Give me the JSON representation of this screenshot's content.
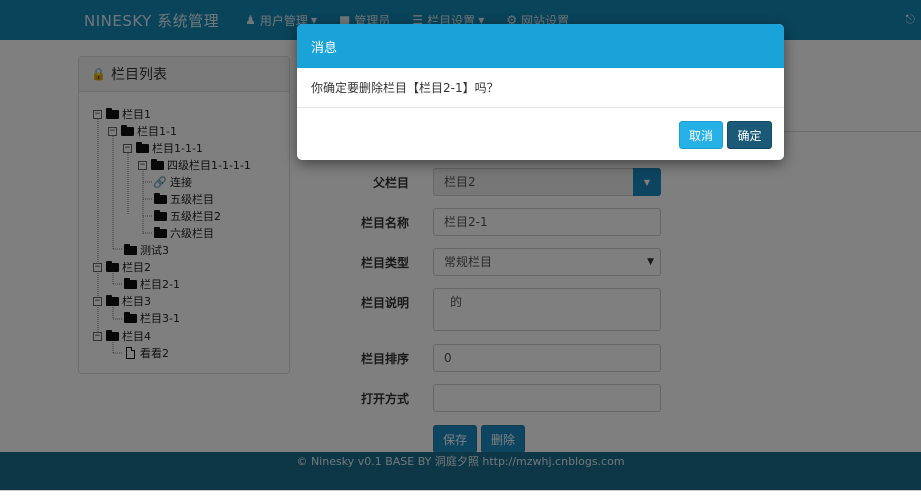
{
  "navbar": {
    "brand": "NINESKY 系统管理",
    "items": [
      {
        "label": "用户管理",
        "icon": "user-icon",
        "dropdown": true
      },
      {
        "label": "管理员",
        "icon": "lock-icon",
        "dropdown": false
      },
      {
        "label": "栏目设置",
        "icon": "list-icon",
        "dropdown": true
      },
      {
        "label": "网站设置",
        "icon": "gear-icon",
        "dropdown": false
      }
    ],
    "right_icon": "logout-icon"
  },
  "sidebar": {
    "title": "栏目列表",
    "tree": [
      {
        "label": "栏目1",
        "type": "folder",
        "expanded": true
      },
      {
        "label": "栏目1-1",
        "type": "folder",
        "expanded": true
      },
      {
        "label": "栏目1-1-1",
        "type": "folder",
        "expanded": true
      },
      {
        "label": "四级栏目1-1-1-1",
        "type": "folder",
        "expanded": true
      },
      {
        "label": "连接",
        "type": "link"
      },
      {
        "label": "五级栏目",
        "type": "folder"
      },
      {
        "label": "五级栏目2",
        "type": "folder"
      },
      {
        "label": "六级栏目",
        "type": "folder"
      },
      {
        "label": "测试3",
        "type": "folder"
      },
      {
        "label": "栏目2",
        "type": "folder",
        "expanded": true
      },
      {
        "label": "栏目2-1",
        "type": "folder"
      },
      {
        "label": "栏目3",
        "type": "folder",
        "expanded": true
      },
      {
        "label": "栏目3-1",
        "type": "folder"
      },
      {
        "label": "栏目4",
        "type": "folder",
        "expanded": true
      },
      {
        "label": "看看2",
        "type": "file"
      }
    ]
  },
  "form": {
    "parent": {
      "label": "父栏目",
      "value": "栏目2"
    },
    "name": {
      "label": "栏目名称",
      "value": "栏目2-1"
    },
    "type": {
      "label": "栏目类型",
      "value": "常规栏目"
    },
    "description": {
      "label": "栏目说明",
      "value": "的"
    },
    "order": {
      "label": "栏目排序",
      "value": "0"
    },
    "open_mode": {
      "label": "打开方式",
      "value": ""
    },
    "save_label": "保存",
    "delete_label": "删除"
  },
  "footer": {
    "text": "© Ninesky v0.1 BASE BY 洞庭夕照 http://mzwhj.cnblogs.com"
  },
  "modal": {
    "title": "消息",
    "message": "你确定要删除栏目【栏目2-1】吗？",
    "cancel_label": "取消",
    "ok_label": "确定"
  },
  "colors": {
    "navbar": "#1489b4",
    "modal_header": "#1aa3d8",
    "cancel_button": "#26b1e6",
    "ok_button": "#1a5a78",
    "footer": "#1b6f8f"
  }
}
